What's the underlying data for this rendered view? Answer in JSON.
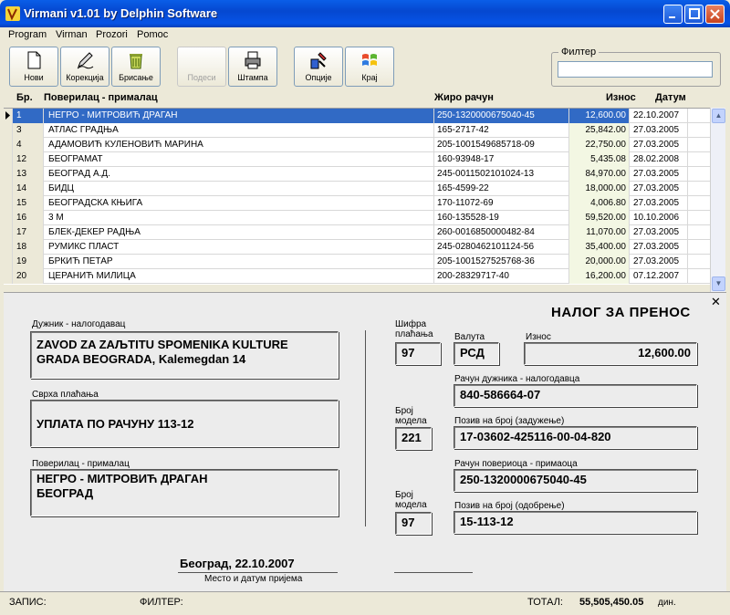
{
  "window": {
    "title": "Virmani v1.01 by Delphin Software"
  },
  "menu": [
    "Program",
    "Virman",
    "Prozori",
    "Pomoc"
  ],
  "toolbar": {
    "new": "Нови",
    "edit": "Корекција",
    "delete": "Брисање",
    "settings": "Подеси",
    "print": "Штампа",
    "options": "Опције",
    "exit": "Крај"
  },
  "filter": {
    "legend": "Филтер",
    "value": ""
  },
  "grid": {
    "headers": {
      "no": "Бр.",
      "name": "Поверилац - прималац",
      "account": "Жиро рачун",
      "amount": "Износ",
      "date": "Датум"
    },
    "rows": [
      {
        "no": "1",
        "name": "НЕГРО - МИТРОВИЋ ДРАГАН",
        "account": "250-1320000675040-45",
        "amount": "12,600.00",
        "date": "22.10.2007"
      },
      {
        "no": "3",
        "name": "АТЛАС ГРАДЊА",
        "account": "165-2717-42",
        "amount": "25,842.00",
        "date": "27.03.2005"
      },
      {
        "no": "4",
        "name": "АДАМОВИЋ КУЛЕНОВИЋ МАРИНА",
        "account": "205-1001549685718-09",
        "amount": "22,750.00",
        "date": "27.03.2005"
      },
      {
        "no": "12",
        "name": "БЕОГРАМАТ",
        "account": "160-93948-17",
        "amount": "5,435.08",
        "date": "28.02.2008"
      },
      {
        "no": "13",
        "name": "БЕОГРАД А.Д.",
        "account": "245-0011502101024-13",
        "amount": "84,970.00",
        "date": "27.03.2005"
      },
      {
        "no": "14",
        "name": "БИДЦ",
        "account": "165-4599-22",
        "amount": "18,000.00",
        "date": "27.03.2005"
      },
      {
        "no": "15",
        "name": "БЕОГРАДСКА КЊИГА",
        "account": "170-11072-69",
        "amount": "4,006.80",
        "date": "27.03.2005"
      },
      {
        "no": "16",
        "name": "3 M",
        "account": "160-135528-19",
        "amount": "59,520.00",
        "date": "10.10.2006"
      },
      {
        "no": "17",
        "name": "БЛЕК-ДЕКЕР РАДЊА",
        "account": "260-0016850000482-84",
        "amount": "11,070.00",
        "date": "27.03.2005"
      },
      {
        "no": "18",
        "name": "РУМИКС ПЛАСТ",
        "account": "245-0280462101124-56",
        "amount": "35,400.00",
        "date": "27.03.2005"
      },
      {
        "no": "19",
        "name": "БРКИЋ ПЕТАР",
        "account": "205-1001527525768-36",
        "amount": "20,000.00",
        "date": "27.03.2005"
      },
      {
        "no": "20",
        "name": "ЦЕРАНИЋ МИЛИЦА",
        "account": "200-28329717-40",
        "amount": "16,200.00",
        "date": "07.12.2007"
      }
    ]
  },
  "form": {
    "title": "НАЛОГ ЗА ПРЕНОС",
    "debtor_label": "Дужник - налогодавац",
    "debtor_line1": "ZAVOD ZA ZAЉTITU SPOMENIKA KULTURE",
    "debtor_line2": "GRADA BEOGRADA, Kalemegdan 14",
    "purpose_label": "Сврха плаћања",
    "purpose": "УПЛАТА ПО РАЧУНУ 113-12",
    "creditor_label": "Поверилац - прималац",
    "creditor_line1": "НЕГРО - МИТРОВИЋ ДРАГАН",
    "creditor_line2": "БЕОГРАД",
    "payment_code_label1": "Шифра",
    "payment_code_label2": "плаћања",
    "payment_code": "97",
    "currency_label": "Валута",
    "currency": "РСД",
    "amount_label": "Износ",
    "amount": "12,600.00",
    "debtor_account_label": "Рачун дужника - налогодавца",
    "debtor_account": "840-586664-07",
    "model_label1": "Број",
    "model_label2": "модела",
    "model1": "221",
    "ref_debit_label": "Позив на број (задужење)",
    "ref_debit": "17-03602-425116-00-04-820",
    "creditor_account_label": "Рачун повериоца - примаоца",
    "creditor_account": "250-1320000675040-45",
    "model2": "97",
    "ref_credit_label": "Позив на број (одобрење)",
    "ref_credit": "15-113-12",
    "place_date": "Београд,  22.10.2007",
    "place_date_label": "Место и датум пријема",
    "close_glyph": "✕"
  },
  "status": {
    "record_label": "ЗАПИС:",
    "filter_label": "ФИЛТЕР:",
    "total_label": "ТОТАЛ:",
    "total_value": "55,505,450.05",
    "total_unit": "дин."
  }
}
